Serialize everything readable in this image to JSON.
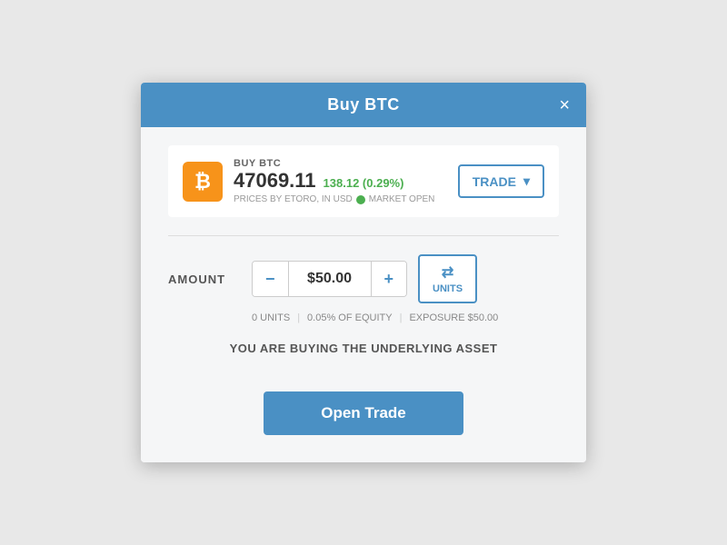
{
  "modal": {
    "title": "Buy BTC",
    "close_label": "×"
  },
  "asset": {
    "icon_symbol": "₿",
    "buy_label": "BUY BTC",
    "price": "47069.11",
    "change": "138.12 (0.29%)",
    "source": "PRICES BY ETORO, IN USD",
    "market_status": "MARKET OPEN"
  },
  "trade_dropdown": {
    "label": "TRADE",
    "chevron": "▾"
  },
  "amount_section": {
    "label": "AMOUNT",
    "minus_label": "−",
    "value": "$50.00",
    "plus_label": "+",
    "units_arrows": "⇄",
    "units_label": "UNITS"
  },
  "info": {
    "units": "0 UNITS",
    "equity_pct": "0.05% OF EQUITY",
    "exposure": "EXPOSURE $50.00"
  },
  "underlying_msg": "YOU ARE BUYING THE UNDERLYING ASSET",
  "open_trade_btn": "Open Trade"
}
